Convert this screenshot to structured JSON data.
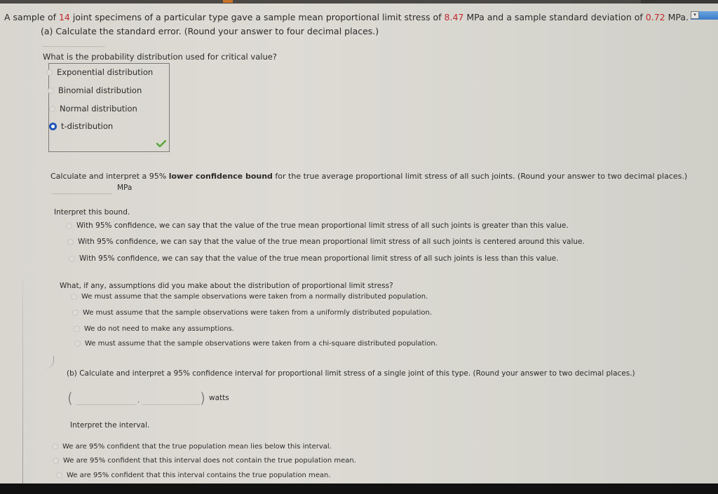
{
  "problem": {
    "intro_prefix": "A sample of ",
    "n": "14",
    "intro_mid1": " joint specimens of a particular type gave a sample mean proportional limit stress of ",
    "mean": "8.47",
    "intro_mid2": " MPa and a sample standard deviation of ",
    "sd": "0.72",
    "intro_suffix": " MPa.",
    "colors": {
      "given_value": "#c0282f",
      "selected_radio": "#1f55b8",
      "correct_check": "#5aa83c"
    }
  },
  "part_a": {
    "prompt": "(a) Calculate the standard error. (Round your answer to four decimal places.)",
    "distribution_question": "What is the probability distribution used for critical value?",
    "distribution_options": [
      {
        "label": "Exponential distribution",
        "selected": false
      },
      {
        "label": "Binomial distribution",
        "selected": false
      },
      {
        "label": "Normal distribution",
        "selected": false
      },
      {
        "label": "t-distribution",
        "selected": true
      }
    ],
    "feedback_icon": "check-icon",
    "bound_prompt_pre": "Calculate and interpret a 95% ",
    "bound_prompt_bold": "lower confidence bound",
    "bound_prompt_post": " for the true average proportional limit stress of all such joints. (Round your answer to two decimal places.)",
    "bound_value": "",
    "bound_unit": "MPa",
    "interpret_label": "Interpret this bound.",
    "interpret_options": [
      "With 95% confidence, we can say that the value of the true mean proportional limit stress of all such joints is greater than this value.",
      "With 95% confidence, we can say that the value of the true mean proportional limit stress of all such joints is centered around this value.",
      "With 95% confidence, we can say that the value of the true mean proportional limit stress of all such joints is less than this value."
    ],
    "assumption_label": "What, if any, assumptions did you make about the distribution of proportional limit stress?",
    "assumption_options": [
      "We must assume that the sample observations were taken from a normally distributed population.",
      "We must assume that the sample observations were taken from a uniformly distributed population.",
      "We do not need to make any assumptions.",
      "We must assume that the sample observations were taken from a chi-square distributed population."
    ]
  },
  "part_b": {
    "prompt": "(b) Calculate and interpret a 95% confidence interval for proportional limit stress of a single joint of this type. (Round your answer to two decimal places.)",
    "open_paren": "(",
    "comma": ",",
    "close_paren": ")",
    "lower_value": "",
    "upper_value": "",
    "unit": "watts",
    "interpret_label": "Interpret the interval.",
    "interpret_options": [
      "We are 95% confident that the true population mean lies below this interval.",
      "We are 95% confident that this interval does not contain the true population mean.",
      "We are 95% confident that this interval contains the true population mean."
    ]
  },
  "scroll_widget": {
    "icon": "dropdown-arrow-icon",
    "glyph": "▾"
  }
}
